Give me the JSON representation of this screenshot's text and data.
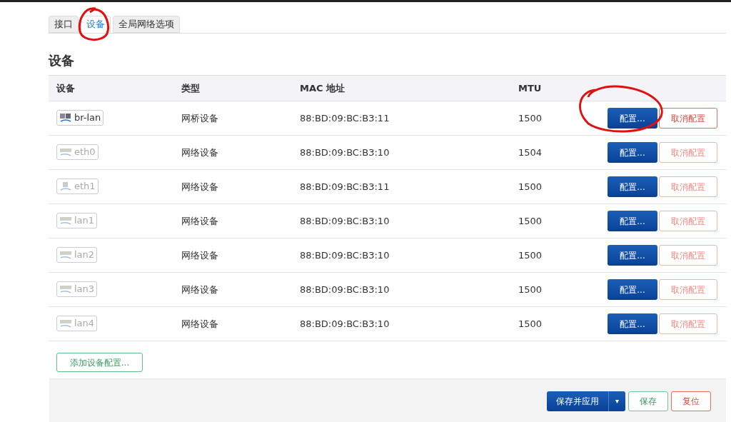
{
  "tabs": [
    {
      "label": "接口",
      "selected": false
    },
    {
      "label": "设备",
      "selected": true
    },
    {
      "label": "全局网络选项",
      "selected": false
    }
  ],
  "heading": "设备",
  "table": {
    "columns": [
      "设备",
      "类型",
      "MAC 地址",
      "MTU"
    ],
    "rows": [
      {
        "device": "br-lan",
        "kind": "bridge",
        "configured": true,
        "type": "网桥设备",
        "mac": "88:BD:09:BC:B3:11",
        "mtu": "1500",
        "configure": "配置...",
        "unconfigure": "取消配置"
      },
      {
        "device": "eth0",
        "kind": "switch",
        "configured": false,
        "type": "网络设备",
        "mac": "88:BD:09:BC:B3:10",
        "mtu": "1504",
        "configure": "配置...",
        "unconfigure": "取消配置"
      },
      {
        "device": "eth1",
        "kind": "port",
        "configured": false,
        "type": "网络设备",
        "mac": "88:BD:09:BC:B3:11",
        "mtu": "1500",
        "configure": "配置...",
        "unconfigure": "取消配置"
      },
      {
        "device": "lan1",
        "kind": "switch",
        "configured": false,
        "type": "网络设备",
        "mac": "88:BD:09:BC:B3:10",
        "mtu": "1500",
        "configure": "配置...",
        "unconfigure": "取消配置"
      },
      {
        "device": "lan2",
        "kind": "switch",
        "configured": false,
        "type": "网络设备",
        "mac": "88:BD:09:BC:B3:10",
        "mtu": "1500",
        "configure": "配置...",
        "unconfigure": "取消配置"
      },
      {
        "device": "lan3",
        "kind": "switch",
        "configured": false,
        "type": "网络设备",
        "mac": "88:BD:09:BC:B3:10",
        "mtu": "1500",
        "configure": "配置...",
        "unconfigure": "取消配置"
      },
      {
        "device": "lan4",
        "kind": "switch",
        "configured": false,
        "type": "网络设备",
        "mac": "88:BD:09:BC:B3:10",
        "mtu": "1500",
        "configure": "配置...",
        "unconfigure": "取消配置"
      }
    ]
  },
  "add_button": "添加设备配置...",
  "footer": {
    "save_apply": "保存并应用",
    "dropdown": "▾",
    "save": "保存",
    "reset": "复位"
  }
}
